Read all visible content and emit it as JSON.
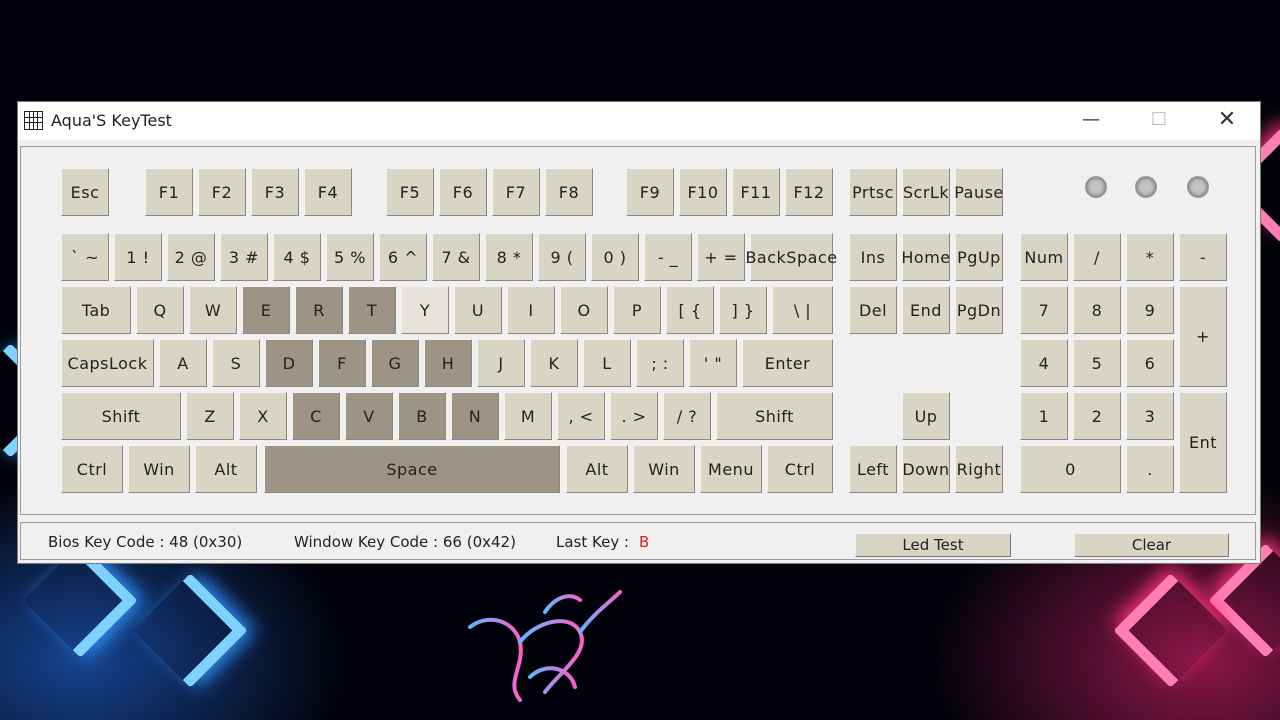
{
  "window": {
    "title": "Aqua'S KeyTest",
    "controls": {
      "minimize": "—",
      "maximize": "☐",
      "close": "✕"
    }
  },
  "keyboard": {
    "keys": [
      {
        "id": "esc",
        "label": "Esc",
        "state": "normal"
      },
      {
        "id": "f1",
        "label": "F1",
        "state": "normal"
      },
      {
        "id": "f2",
        "label": "F2",
        "state": "normal"
      },
      {
        "id": "f3",
        "label": "F3",
        "state": "normal"
      },
      {
        "id": "f4",
        "label": "F4",
        "state": "normal"
      },
      {
        "id": "f5",
        "label": "F5",
        "state": "normal"
      },
      {
        "id": "f6",
        "label": "F6",
        "state": "normal"
      },
      {
        "id": "f7",
        "label": "F7",
        "state": "normal"
      },
      {
        "id": "f8",
        "label": "F8",
        "state": "normal"
      },
      {
        "id": "f9",
        "label": "F9",
        "state": "normal"
      },
      {
        "id": "f10",
        "label": "F10",
        "state": "normal"
      },
      {
        "id": "f11",
        "label": "F11",
        "state": "normal"
      },
      {
        "id": "f12",
        "label": "F12",
        "state": "normal"
      },
      {
        "id": "prtsc",
        "label": "Prtsc",
        "state": "normal"
      },
      {
        "id": "scrlk",
        "label": "ScrLk",
        "state": "normal"
      },
      {
        "id": "pause",
        "label": "Pause",
        "state": "normal"
      },
      {
        "id": "backtick",
        "label": "` ~",
        "state": "normal"
      },
      {
        "id": "1",
        "label": "1 !",
        "state": "normal"
      },
      {
        "id": "2",
        "label": "2 @",
        "state": "normal"
      },
      {
        "id": "3",
        "label": "3 #",
        "state": "normal"
      },
      {
        "id": "4",
        "label": "4 $",
        "state": "normal"
      },
      {
        "id": "5",
        "label": "5 %",
        "state": "normal"
      },
      {
        "id": "6",
        "label": "6 ^",
        "state": "normal"
      },
      {
        "id": "7",
        "label": "7 &",
        "state": "normal"
      },
      {
        "id": "8",
        "label": "8 *",
        "state": "normal"
      },
      {
        "id": "9",
        "label": "9 (",
        "state": "normal"
      },
      {
        "id": "0",
        "label": "0 )",
        "state": "normal"
      },
      {
        "id": "minus",
        "label": "- _",
        "state": "normal"
      },
      {
        "id": "equals",
        "label": "+ =",
        "state": "normal"
      },
      {
        "id": "backspace",
        "label": "BackSpace",
        "state": "normal"
      },
      {
        "id": "tab",
        "label": "Tab",
        "state": "normal"
      },
      {
        "id": "q",
        "label": "Q",
        "state": "normal"
      },
      {
        "id": "w",
        "label": "W",
        "state": "normal"
      },
      {
        "id": "e",
        "label": "E",
        "state": "tested"
      },
      {
        "id": "r",
        "label": "R",
        "state": "tested"
      },
      {
        "id": "t",
        "label": "T",
        "state": "tested"
      },
      {
        "id": "y",
        "label": "Y",
        "state": "light"
      },
      {
        "id": "u",
        "label": "U",
        "state": "normal"
      },
      {
        "id": "i",
        "label": "I",
        "state": "normal"
      },
      {
        "id": "o",
        "label": "O",
        "state": "normal"
      },
      {
        "id": "p",
        "label": "P",
        "state": "normal"
      },
      {
        "id": "lbracket",
        "label": "[ {",
        "state": "normal"
      },
      {
        "id": "rbracket",
        "label": "] }",
        "state": "normal"
      },
      {
        "id": "backslash",
        "label": "\\ |",
        "state": "normal"
      },
      {
        "id": "capslock",
        "label": "CapsLock",
        "state": "normal"
      },
      {
        "id": "a",
        "label": "A",
        "state": "normal"
      },
      {
        "id": "s",
        "label": "S",
        "state": "normal"
      },
      {
        "id": "d",
        "label": "D",
        "state": "tested"
      },
      {
        "id": "f",
        "label": "F",
        "state": "tested"
      },
      {
        "id": "g",
        "label": "G",
        "state": "tested"
      },
      {
        "id": "h",
        "label": "H",
        "state": "tested"
      },
      {
        "id": "j",
        "label": "J",
        "state": "normal"
      },
      {
        "id": "k",
        "label": "K",
        "state": "normal"
      },
      {
        "id": "l",
        "label": "L",
        "state": "normal"
      },
      {
        "id": "semicolon",
        "label": "; :",
        "state": "normal"
      },
      {
        "id": "quote",
        "label": "' \"",
        "state": "normal"
      },
      {
        "id": "enter",
        "label": "Enter",
        "state": "normal"
      },
      {
        "id": "lshift",
        "label": "Shift",
        "state": "normal"
      },
      {
        "id": "z",
        "label": "Z",
        "state": "normal"
      },
      {
        "id": "x",
        "label": "X",
        "state": "normal"
      },
      {
        "id": "c",
        "label": "C",
        "state": "tested"
      },
      {
        "id": "v",
        "label": "V",
        "state": "tested"
      },
      {
        "id": "b",
        "label": "B",
        "state": "tested"
      },
      {
        "id": "n",
        "label": "N",
        "state": "tested"
      },
      {
        "id": "m",
        "label": "M",
        "state": "normal"
      },
      {
        "id": "comma",
        "label": ", <",
        "state": "normal"
      },
      {
        "id": "period",
        "label": ". >",
        "state": "normal"
      },
      {
        "id": "slash",
        "label": "/ ?",
        "state": "normal"
      },
      {
        "id": "rshift",
        "label": "Shift",
        "state": "normal"
      },
      {
        "id": "lctrl",
        "label": "Ctrl",
        "state": "normal"
      },
      {
        "id": "lwin",
        "label": "Win",
        "state": "normal"
      },
      {
        "id": "lalt",
        "label": "Alt",
        "state": "normal"
      },
      {
        "id": "space",
        "label": "Space",
        "state": "tested"
      },
      {
        "id": "ralt",
        "label": "Alt",
        "state": "normal"
      },
      {
        "id": "rwin",
        "label": "Win",
        "state": "normal"
      },
      {
        "id": "menu",
        "label": "Menu",
        "state": "normal"
      },
      {
        "id": "rctrl",
        "label": "Ctrl",
        "state": "normal"
      },
      {
        "id": "ins",
        "label": "Ins",
        "state": "normal"
      },
      {
        "id": "home",
        "label": "Home",
        "state": "normal"
      },
      {
        "id": "pgup",
        "label": "PgUp",
        "state": "normal"
      },
      {
        "id": "del",
        "label": "Del",
        "state": "normal"
      },
      {
        "id": "end",
        "label": "End",
        "state": "normal"
      },
      {
        "id": "pgdn",
        "label": "PgDn",
        "state": "normal"
      },
      {
        "id": "up",
        "label": "Up",
        "state": "normal"
      },
      {
        "id": "left",
        "label": "Left",
        "state": "normal"
      },
      {
        "id": "down",
        "label": "Down",
        "state": "normal"
      },
      {
        "id": "right",
        "label": "Right",
        "state": "normal"
      },
      {
        "id": "numlock",
        "label": "Num",
        "state": "normal"
      },
      {
        "id": "numdiv",
        "label": "/",
        "state": "normal"
      },
      {
        "id": "nummul",
        "label": "*",
        "state": "normal"
      },
      {
        "id": "numsub",
        "label": "-",
        "state": "normal"
      },
      {
        "id": "num7",
        "label": "7",
        "state": "normal"
      },
      {
        "id": "num8",
        "label": "8",
        "state": "normal"
      },
      {
        "id": "num9",
        "label": "9",
        "state": "normal"
      },
      {
        "id": "numadd",
        "label": "+",
        "state": "normal"
      },
      {
        "id": "num4",
        "label": "4",
        "state": "normal"
      },
      {
        "id": "num5",
        "label": "5",
        "state": "normal"
      },
      {
        "id": "num6",
        "label": "6",
        "state": "normal"
      },
      {
        "id": "num1",
        "label": "1",
        "state": "normal"
      },
      {
        "id": "num2",
        "label": "2",
        "state": "normal"
      },
      {
        "id": "num3",
        "label": "3",
        "state": "normal"
      },
      {
        "id": "numenter",
        "label": "Ent",
        "state": "normal"
      },
      {
        "id": "num0",
        "label": "0",
        "state": "normal"
      },
      {
        "id": "numdot",
        "label": ".",
        "state": "normal"
      }
    ],
    "leds": [
      "num-lock-led",
      "caps-lock-led",
      "scroll-lock-led"
    ]
  },
  "status": {
    "bios_key_code": "Bios Key Code : 48 (0x30)",
    "window_key_code": "Window Key Code : 66 (0x42)",
    "last_key_label": "Last Key :",
    "last_key_value": "B",
    "led_test_label": "Led Test",
    "clear_label": "Clear"
  },
  "colors": {
    "key_normal": "#d8d5c4",
    "key_tested": "#9e9485",
    "key_light": "#e6e4d8",
    "last_key": "#e02020"
  }
}
